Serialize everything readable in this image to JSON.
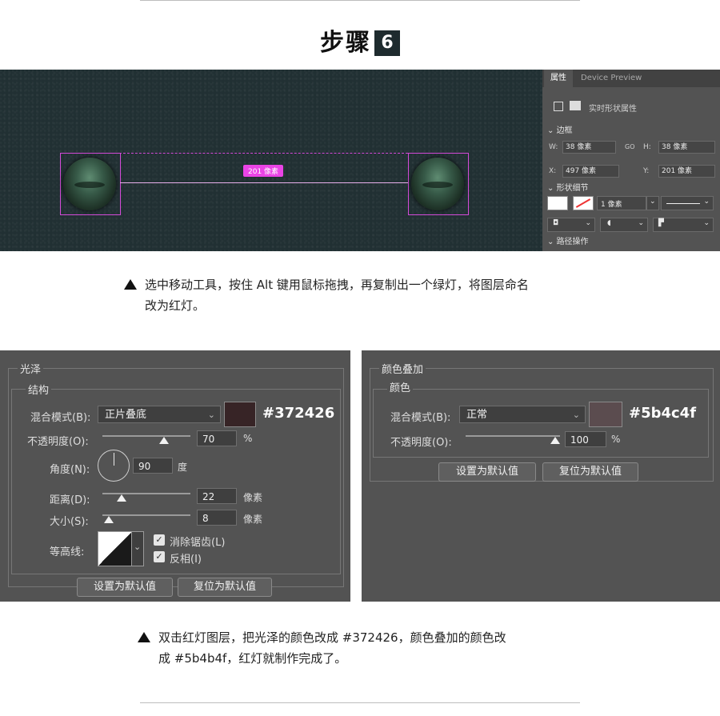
{
  "step": {
    "title": "步骤",
    "number": "6"
  },
  "canvas": {
    "distance_label": "201 像素"
  },
  "properties_panel": {
    "tab_properties": "属性",
    "tab_device_preview": "Device Preview",
    "live_shape_label": "实时形状属性",
    "section_transform": "边框",
    "w_label": "W:",
    "w_value": "38 像素",
    "link_label": "GO",
    "h_label": "H:",
    "h_value": "38 像素",
    "x_label": "X:",
    "x_value": "497 像素",
    "y_label": "Y:",
    "y_value": "201 像素",
    "section_appearance": "形状细节",
    "stroke_width": "1 像素",
    "section_path_ops": "路径操作"
  },
  "caption1": {
    "line1": "选中移动工具，按住 Alt 键用鼠标拖拽，再复制出一个绿灯，将图层命名",
    "line2": "改为红灯。"
  },
  "satin_dialog": {
    "title": "光泽",
    "group": "结构",
    "blend_mode_label": "混合模式(B):",
    "blend_mode_value": "正片叠底",
    "color_hex": "#372426",
    "opacity_label": "不透明度(O):",
    "opacity_value": "70",
    "opacity_unit": "%",
    "angle_label": "角度(N):",
    "angle_value": "90",
    "angle_unit": "度",
    "distance_label": "距离(D):",
    "distance_value": "22",
    "distance_unit": "像素",
    "size_label": "大小(S):",
    "size_value": "8",
    "size_unit": "像素",
    "contour_label": "等高线:",
    "antialias_label": "消除锯齿(L)",
    "invert_label": "反相(I)",
    "set_default_btn": "设置为默认值",
    "reset_default_btn": "复位为默认值"
  },
  "color_overlay_dialog": {
    "title": "颜色叠加",
    "group": "颜色",
    "blend_mode_label": "混合模式(B):",
    "blend_mode_value": "正常",
    "color_hex": "#5b4c4f",
    "opacity_label": "不透明度(O):",
    "opacity_value": "100",
    "opacity_unit": "%",
    "set_default_btn": "设置为默认值",
    "reset_default_btn": "复位为默认值"
  },
  "caption2": {
    "line1": "双击红灯图层，把光泽的颜色改成 #372426，颜色叠加的颜色改",
    "line2": "成 #5b4b4f，红灯就制作完成了。"
  },
  "colors": {
    "satin_swatch": "#372426",
    "overlay_swatch": "#5b4c4f",
    "selection_accent": "#ea44e6",
    "canvas_bg": "#213033"
  },
  "slider_levels": {
    "satin_opacity_pct": 70,
    "satin_distance_pct": 22,
    "satin_size_pct": 8,
    "overlay_opacity_pct": 100
  }
}
